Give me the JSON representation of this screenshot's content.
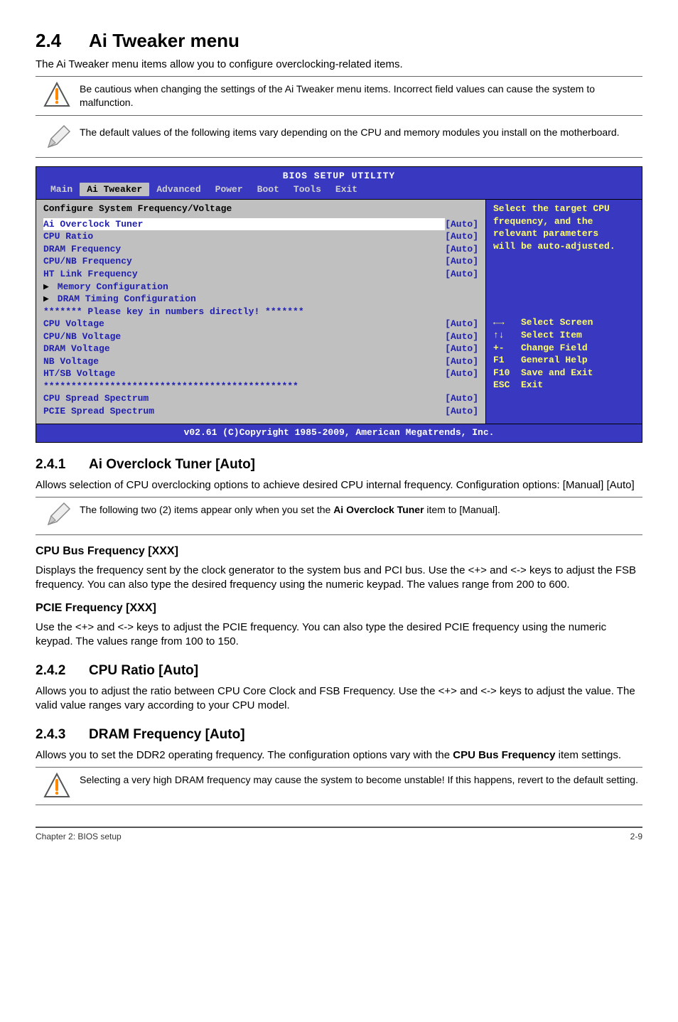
{
  "section": {
    "num": "2.4",
    "title": "Ai Tweaker menu",
    "intro": "The Ai Tweaker menu items allow you to configure overclocking-related items."
  },
  "callouts": {
    "warn1": "Be cautious when changing the settings of the Ai Tweaker menu items. Incorrect field values can cause the system to malfunction.",
    "note1": "The default values of the following items vary depending on the CPU and memory modules you install on the motherboard.",
    "note2_prefix": "The following two (2) items appear only when you set the ",
    "note2_bold": "Ai Overclock Tuner",
    "note2_suffix": " item to [Manual].",
    "warn2": "Selecting a very high DRAM frequency may cause the system to become unstable! If this happens, revert to the default setting."
  },
  "bios": {
    "title": "BIOS SETUP UTILITY",
    "menu": [
      "Main",
      "Ai Tweaker",
      "Advanced",
      "Power",
      "Boot",
      "Tools",
      "Exit"
    ],
    "active_menu_index": 1,
    "panel_title": "Configure System Frequency/Voltage",
    "items": [
      {
        "label": "Ai Overclock Tuner",
        "value": "[Auto]",
        "hl": true
      },
      {
        "label": "CPU Ratio",
        "value": "[Auto]"
      },
      {
        "label": "DRAM Frequency",
        "value": "[Auto]"
      },
      {
        "label": "CPU/NB Frequency",
        "value": "[Auto]"
      },
      {
        "label": "HT Link Frequency",
        "value": "[Auto]"
      },
      {
        "label": "Memory Configuration",
        "sub": true
      },
      {
        "label": "DRAM Timing Configuration",
        "sub": true
      },
      {
        "label": "******* Please key in numbers directly! *******",
        "divider": true
      },
      {
        "label": "CPU Voltage",
        "value": "[Auto]"
      },
      {
        "label": "CPU/NB Voltage",
        "value": "[Auto]"
      },
      {
        "label": "DRAM Voltage",
        "value": "[Auto]"
      },
      {
        "label": "NB Voltage",
        "value": "[Auto]"
      },
      {
        "label": "HT/SB Voltage",
        "value": "[Auto]"
      },
      {
        "label": "**********************************************",
        "divider": true
      },
      {
        "label": "CPU Spread Spectrum",
        "value": "[Auto]"
      },
      {
        "label": "PCIE Spread Spectrum",
        "value": "[Auto]"
      }
    ],
    "help_top": [
      "Select the target CPU",
      "frequency, and the",
      "relevant parameters",
      "will be auto-adjusted."
    ],
    "help_keys": [
      {
        "k": "←→",
        "t": "Select Screen"
      },
      {
        "k": "↑↓",
        "t": "Select Item"
      },
      {
        "k": "+-",
        "t": "Change Field"
      },
      {
        "k": "F1",
        "t": "General Help"
      },
      {
        "k": "F10",
        "t": "Save and Exit"
      },
      {
        "k": "ESC",
        "t": "Exit"
      }
    ],
    "footer": "v02.61 (C)Copyright 1985-2009, American Megatrends, Inc."
  },
  "s241": {
    "num": "2.4.1",
    "title": "Ai Overclock Tuner [Auto]",
    "p": "Allows selection of CPU overclocking options to achieve desired CPU internal frequency. Configuration options: [Manual] [Auto]"
  },
  "cpu_bus": {
    "title": "CPU Bus Frequency [XXX]",
    "p": "Displays the frequency sent by the clock generator to the system bus and PCI bus. Use the <+> and <-> keys to adjust the FSB frequency. You can also type the desired frequency using the numeric keypad. The values range from 200 to 600."
  },
  "pcie": {
    "title": "PCIE Frequency [XXX]",
    "p": "Use the <+> and <-> keys to adjust the PCIE frequency. You can also type the desired PCIE frequency using the numeric keypad. The values range from 100 to 150."
  },
  "s242": {
    "num": "2.4.2",
    "title": "CPU Ratio [Auto]",
    "p": "Allows you to adjust the ratio between CPU Core Clock and FSB Frequency. Use the <+> and <-> keys to adjust the value. The valid value ranges vary according to your CPU model."
  },
  "s243": {
    "num": "2.4.3",
    "title": "DRAM Frequency [Auto]",
    "p_prefix": "Allows you to set the DDR2 operating frequency. The configuration options vary with the ",
    "p_bold": "CPU Bus Frequency",
    "p_suffix": " item settings."
  },
  "footer": {
    "left": "Chapter 2: BIOS setup",
    "right": "2-9"
  }
}
